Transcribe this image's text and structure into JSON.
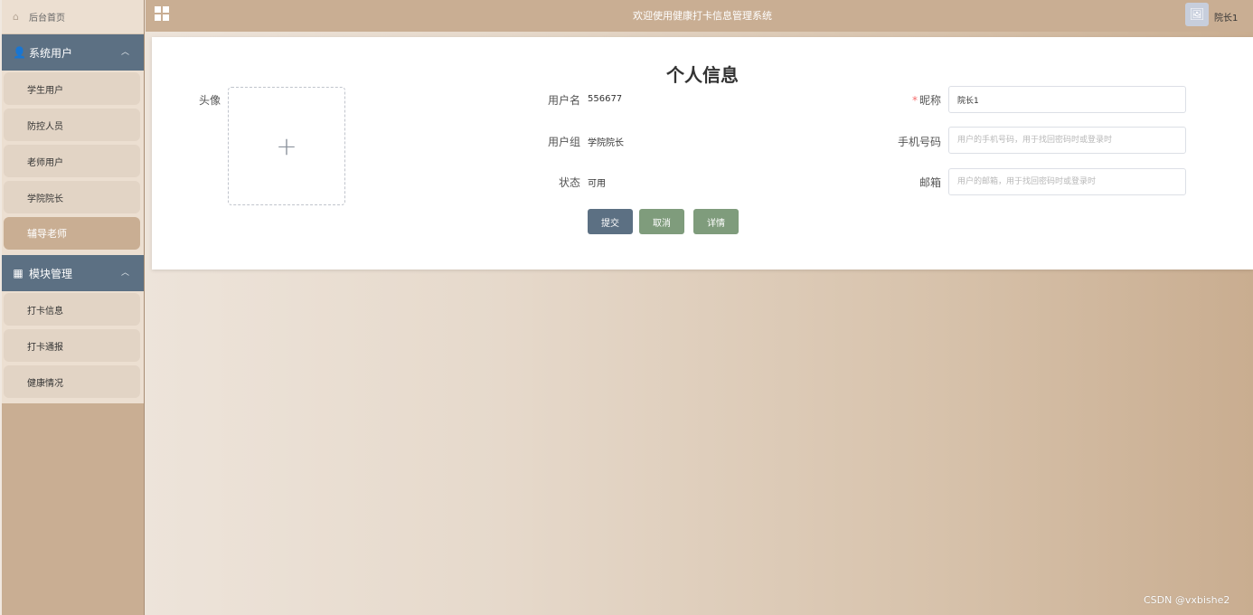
{
  "sidebar": {
    "home_label": "后台首页",
    "home_icon": "home-icon",
    "groups": [
      {
        "title": "系统用户",
        "icon": "user-icon",
        "items": [
          "学生用户",
          "防控人员",
          "老师用户",
          "学院院长",
          "辅导老师"
        ]
      },
      {
        "title": "模块管理",
        "icon": "grid-icon",
        "items": [
          "打卡信息",
          "打卡通报",
          "健康情况"
        ]
      }
    ],
    "active_item": "辅导老师"
  },
  "header": {
    "title": "欢迎使用健康打卡信息管理系统",
    "username": "院长1"
  },
  "form": {
    "title": "个人信息",
    "avatar_label": "头像",
    "upload_plus": "+",
    "username_label": "用户名",
    "username_value": "556677",
    "group_label": "用户组",
    "group_value": "学院院长",
    "status_label": "状态",
    "status_value": "可用",
    "nickname_label": "昵称",
    "nickname_required_mark": "*",
    "nickname_value": "院长1",
    "phone_label": "手机号码",
    "phone_placeholder": "用户的手机号码，用于找回密码时或登录时",
    "email_label": "邮箱",
    "email_placeholder": "用户的邮箱，用于找回密码时或登录时",
    "submit_label": "提交",
    "cancel_label": "取消",
    "detail_label": "详情"
  },
  "watermark": "CSDN @vxbishe2",
  "colors": {
    "sidebar_bg": "#c9ae93",
    "group_header": "#5c7083",
    "submit_button": "#5c7083",
    "secondary_button": "#7f9c7c"
  }
}
